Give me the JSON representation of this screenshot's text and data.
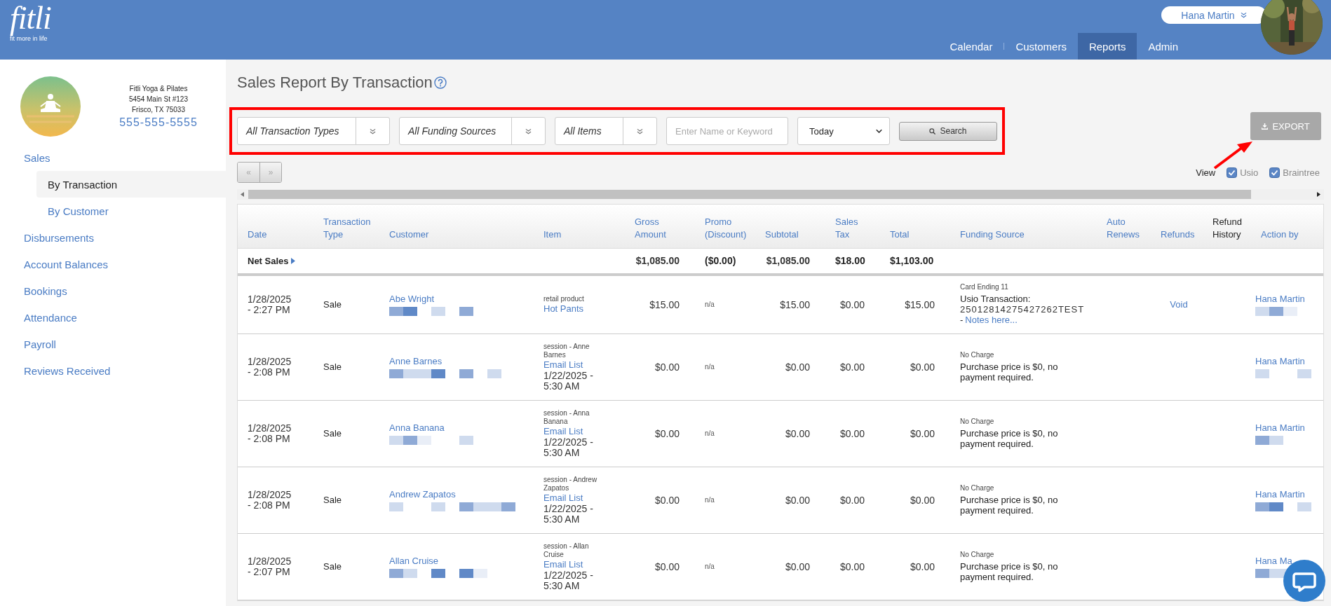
{
  "header": {
    "logo": {
      "wordmark": "fitli",
      "tagline": "fit more in life"
    },
    "user_menu": {
      "name": "Hana Martin"
    },
    "nav": [
      {
        "label": "Calendar",
        "selected": false
      },
      {
        "label": "Customers",
        "selected": false
      },
      {
        "label": "Reports",
        "selected": true
      },
      {
        "label": "Admin",
        "selected": false
      }
    ]
  },
  "business": {
    "name": "Fitli Yoga & Pilates",
    "address": "5454 Main St #123",
    "city": "Frisco, TX 75033",
    "phone": "555-555-5555"
  },
  "sidebar": {
    "items": [
      {
        "label": "Sales",
        "selected": false,
        "children": [
          {
            "label": "By Transaction",
            "selected": true
          },
          {
            "label": "By Customer",
            "selected": false
          }
        ]
      },
      {
        "label": "Disbursements",
        "selected": false
      },
      {
        "label": "Account Balances",
        "selected": false
      },
      {
        "label": "Bookings",
        "selected": false
      },
      {
        "label": "Attendance",
        "selected": false
      },
      {
        "label": "Payroll",
        "selected": false
      },
      {
        "label": "Reviews Received",
        "selected": false
      }
    ]
  },
  "report": {
    "title": "Sales Report By Transaction"
  },
  "filters": {
    "dropdowns": [
      {
        "label": "All Transaction Types"
      },
      {
        "label": "All Funding Sources"
      },
      {
        "label": "All Items"
      }
    ],
    "keyword": {
      "placeholder": "Enter Name or Keyword"
    },
    "period": {
      "value": "Today"
    },
    "search_button": "Search"
  },
  "export_button": {
    "label": "EXPORT",
    "disabled": true
  },
  "pager": [
    {
      "label": "«"
    },
    {
      "label": "»"
    }
  ],
  "view": {
    "label": "View",
    "options": [
      {
        "label": "Usio",
        "checked": true
      },
      {
        "label": "Braintree",
        "checked": true
      }
    ]
  },
  "table": {
    "columns": [
      {
        "label": "Date",
        "sortable": true
      },
      {
        "label": "Transaction Type",
        "sortable": true
      },
      {
        "label": "Customer",
        "sortable": true
      },
      {
        "label": "Item",
        "sortable": true
      },
      {
        "label": "Gross Amount",
        "sortable": true
      },
      {
        "label": "Promo (Discount)",
        "sortable": true
      },
      {
        "label": "Subtotal",
        "sortable": true
      },
      {
        "label": "Sales Tax",
        "sortable": true
      },
      {
        "label": "Total",
        "sortable": true
      },
      {
        "label": "Funding Source",
        "sortable": true
      },
      {
        "label": "Auto Renews",
        "sortable": true
      },
      {
        "label": "Refunds",
        "sortable": true
      },
      {
        "label": "Refund History",
        "sortable": false
      },
      {
        "label": "Action by",
        "sortable": true
      }
    ],
    "net_sales": {
      "label": "Net Sales",
      "gross": "$1,085.00",
      "promo": "($0.00)",
      "subtotal": "$1,085.00",
      "tax": "$18.00",
      "total": "$1,103.00"
    },
    "rows": [
      {
        "date": "1/28/2025",
        "time": "- 2:27 PM",
        "type": "Sale",
        "customer": "Abe Wright",
        "item_category": "retail product",
        "item": "Hot Pants",
        "gross": "$15.00",
        "promo": "n/a",
        "subtotal": "$15.00",
        "tax": "$0.00",
        "total": "$15.00",
        "funding_note": "Card Ending 11",
        "funding_text": "Usio Transaction:",
        "transaction_id": "25012814275427262TEST",
        "notes_prefix": "-",
        "notes_link": "Notes here...",
        "refund_action": "Void",
        "action_by": "Hana Martin"
      },
      {
        "date": "1/28/2025",
        "time": "- 2:08 PM",
        "type": "Sale",
        "customer": "Anne Barnes",
        "item_category": "session - Anne Barnes",
        "item": "Email List",
        "item_date": "1/22/2025 - 5:30 AM",
        "gross": "$0.00",
        "promo": "n/a",
        "subtotal": "$0.00",
        "tax": "$0.00",
        "total": "$0.00",
        "funding_note": "No Charge",
        "funding_text": "Purchase price is $0, no payment required.",
        "action_by": "Hana Martin"
      },
      {
        "date": "1/28/2025",
        "time": "- 2:08 PM",
        "type": "Sale",
        "customer": "Anna Banana",
        "item_category": "session - Anna Banana",
        "item": "Email List",
        "item_date": "1/22/2025 - 5:30 AM",
        "gross": "$0.00",
        "promo": "n/a",
        "subtotal": "$0.00",
        "tax": "$0.00",
        "total": "$0.00",
        "funding_note": "No Charge",
        "funding_text": "Purchase price is $0, no payment required.",
        "action_by": "Hana Martin"
      },
      {
        "date": "1/28/2025",
        "time": "- 2:08 PM",
        "type": "Sale",
        "customer": "Andrew Zapatos",
        "item_category": "session - Andrew Zapatos",
        "item": "Email List",
        "item_date": "1/22/2025 - 5:30 AM",
        "gross": "$0.00",
        "promo": "n/a",
        "subtotal": "$0.00",
        "tax": "$0.00",
        "total": "$0.00",
        "funding_note": "No Charge",
        "funding_text": "Purchase price is $0, no payment required.",
        "action_by": "Hana Martin"
      },
      {
        "date": "1/28/2025",
        "time": "- 2:07 PM",
        "type": "Sale",
        "customer": "Allan Cruise",
        "item_category": "session - Allan Cruise",
        "item": "Email List",
        "item_date": "1/22/2025 - 5:30 AM",
        "gross": "$0.00",
        "promo": "n/a",
        "subtotal": "$0.00",
        "tax": "$0.00",
        "total": "$0.00",
        "funding_note": "No Charge",
        "funding_text": "Purchase price is $0, no payment required.",
        "action_by": "Hana Ma"
      }
    ]
  }
}
